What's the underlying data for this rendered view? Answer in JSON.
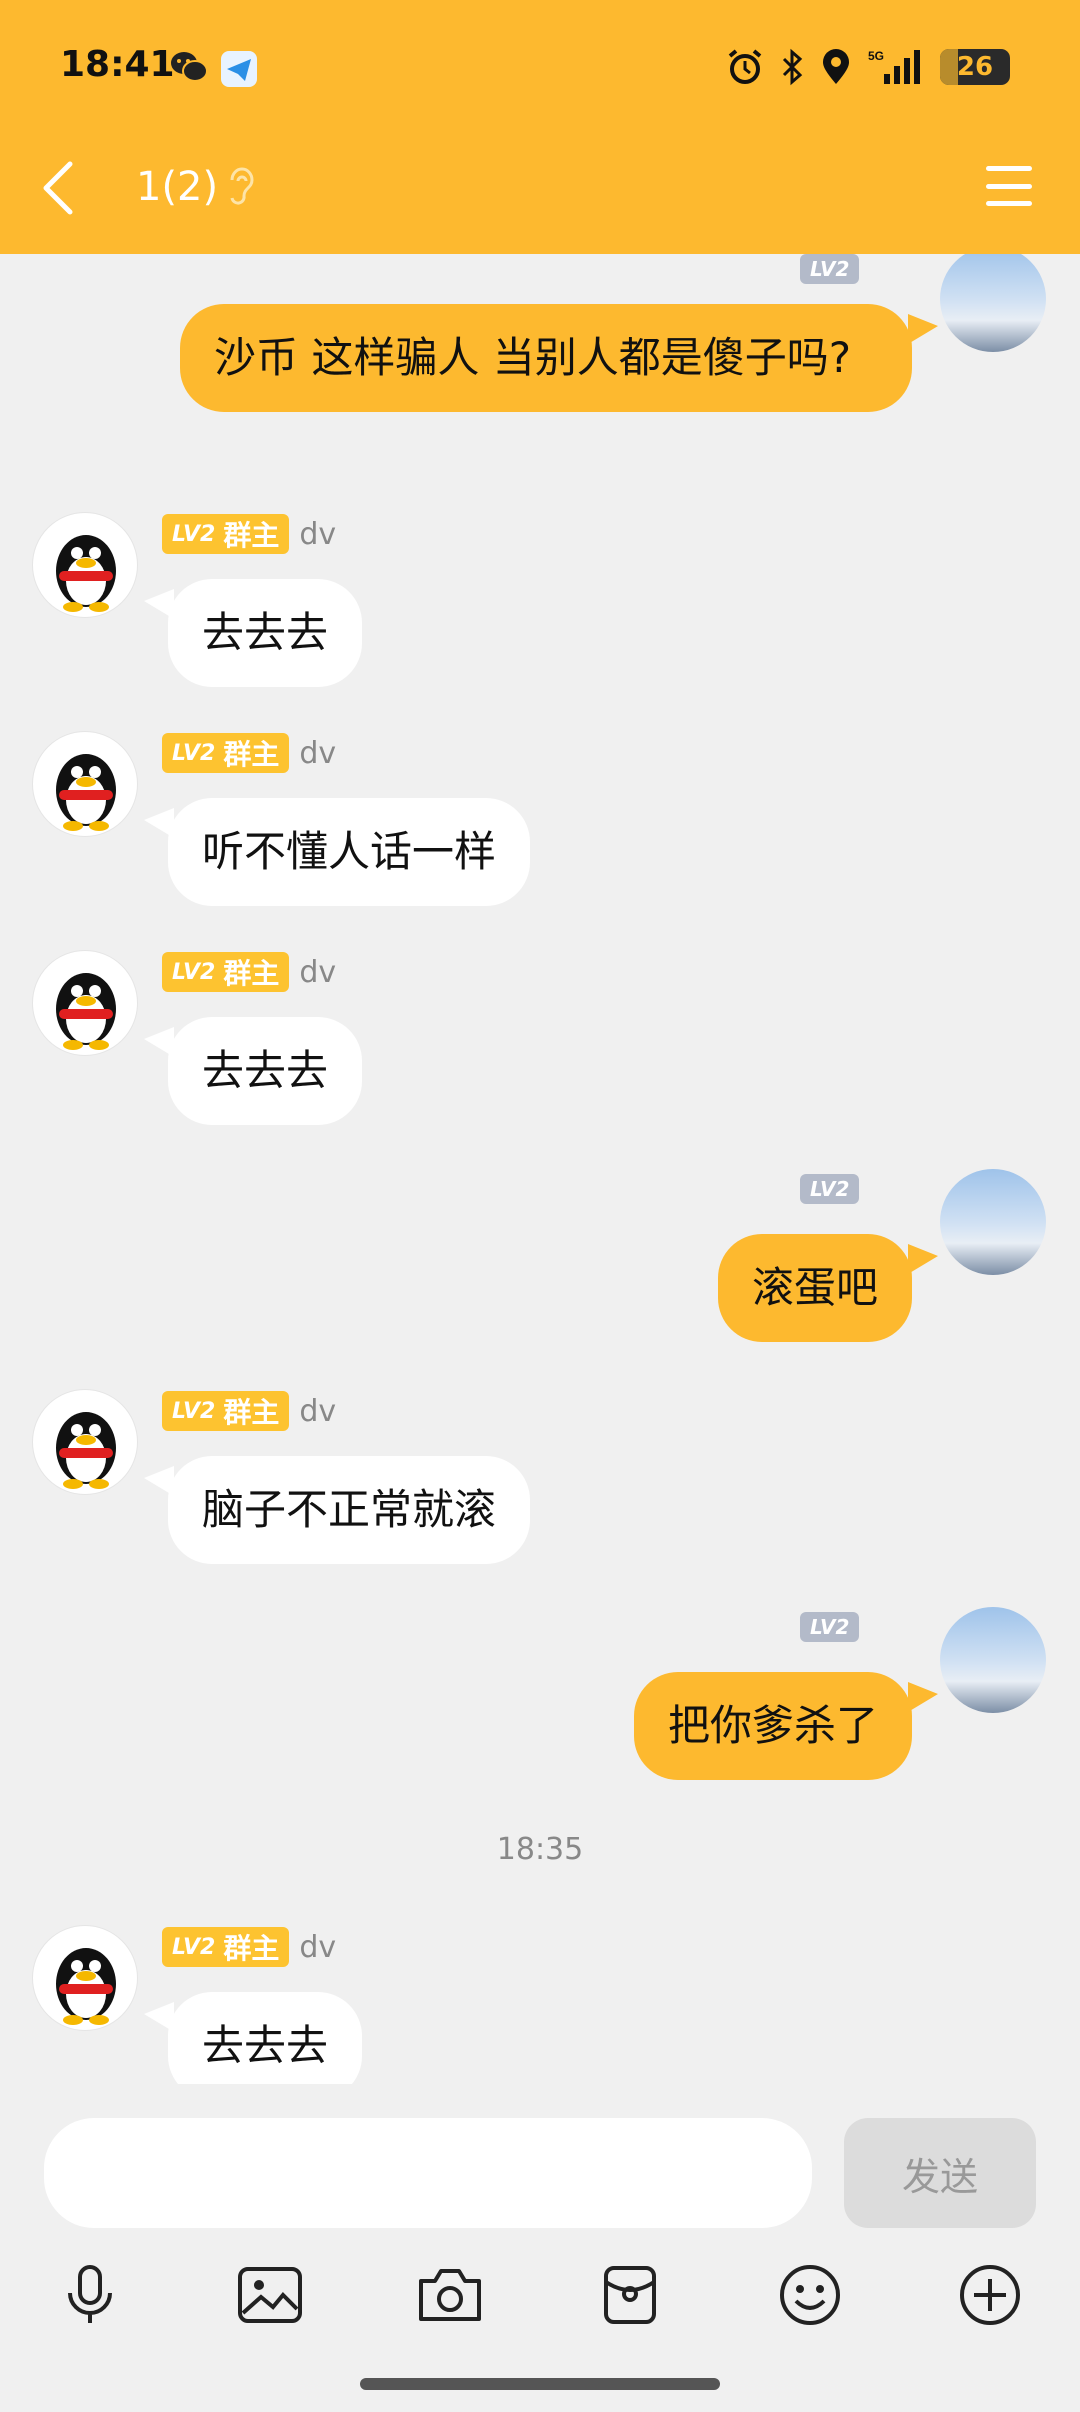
{
  "status": {
    "time": "18:41",
    "battery": "26",
    "battery_fraction": 0.26,
    "network": "5G"
  },
  "header": {
    "title": "1(2)"
  },
  "messages": [
    {
      "side": "out",
      "level": "LV2",
      "text": "沙币 这样骗人 当别人都是傻子吗?"
    },
    {
      "side": "in",
      "level": "LV2",
      "role": "群主",
      "nick": "dv",
      "text": "去去去"
    },
    {
      "side": "in",
      "level": "LV2",
      "role": "群主",
      "nick": "dv",
      "text": "听不懂人话一样"
    },
    {
      "side": "in",
      "level": "LV2",
      "role": "群主",
      "nick": "dv",
      "text": "去去去"
    },
    {
      "side": "out",
      "level": "LV2",
      "text": "滚蛋吧"
    },
    {
      "side": "in",
      "level": "LV2",
      "role": "群主",
      "nick": "dv",
      "text": "脑子不正常就滚"
    },
    {
      "side": "out",
      "level": "LV2",
      "text": "把你爹杀了"
    },
    {
      "side": "in",
      "level": "LV2",
      "role": "群主",
      "nick": "dv",
      "text": "去去去"
    }
  ],
  "timestamp": "18:35",
  "input": {
    "value": "",
    "send_label": "发送"
  },
  "toolbar": [
    "microphone-icon",
    "image-icon",
    "camera-icon",
    "red-packet-icon",
    "emoji-icon",
    "plus-icon"
  ],
  "colors": {
    "accent": "#fdb92f",
    "background": "#f0f0f0",
    "incoming_bubble": "#ffffff"
  }
}
